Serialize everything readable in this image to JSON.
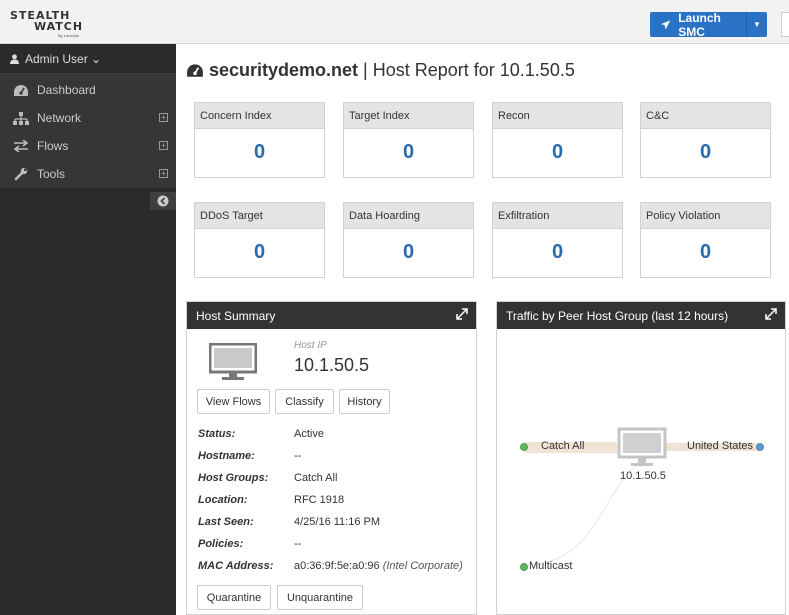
{
  "brand": {
    "line1": "STEALTH",
    "line2": "WATCH",
    "byline": "By Lancope"
  },
  "topbar": {
    "launch_label": "Launch SMC"
  },
  "sidebar": {
    "user": "Admin User ⌄",
    "items": [
      {
        "label": "Dashboard",
        "icon": "dashboard-icon"
      },
      {
        "label": "Network",
        "icon": "sitemap-icon"
      },
      {
        "label": "Flows",
        "icon": "exchange-icon"
      },
      {
        "label": "Tools",
        "icon": "wrench-icon"
      }
    ]
  },
  "page": {
    "domain": "securitydemo.net",
    "subtitle": " | Host Report for 10.1.50.5"
  },
  "indices": [
    {
      "label": "Concern Index",
      "value": "0"
    },
    {
      "label": "Target Index",
      "value": "0"
    },
    {
      "label": "Recon",
      "value": "0"
    },
    {
      "label": "C&C",
      "value": "0"
    },
    {
      "label": "DDoS Target",
      "value": "0"
    },
    {
      "label": "Data Hoarding",
      "value": "0"
    },
    {
      "label": "Exfiltration",
      "value": "0"
    },
    {
      "label": "Policy Violation",
      "value": "0"
    }
  ],
  "host_summary": {
    "title": "Host Summary",
    "host_ip_label": "Host IP",
    "host_ip": "10.1.50.5",
    "buttons": {
      "view_flows": "View Flows",
      "classify": "Classify",
      "history": "History",
      "quarantine": "Quarantine",
      "unquarantine": "Unquarantine"
    },
    "fields": [
      {
        "key": "Status:",
        "value": "Active"
      },
      {
        "key": "Hostname:",
        "value": "--"
      },
      {
        "key": "Host Groups:",
        "value": "Catch All"
      },
      {
        "key": "Location:",
        "value": "RFC 1918"
      },
      {
        "key": "Last Seen:",
        "value": "4/25/16 11:16 PM"
      },
      {
        "key": "Policies:",
        "value": "--"
      },
      {
        "key": "MAC Address:",
        "value": "a0:36:9f:5e:a0:96 "
      }
    ],
    "mac_vendor": "(Intel Corporate)"
  },
  "traffic": {
    "title": "Traffic by Peer Host Group (last 12 hours)",
    "left_top": "Catch All",
    "left_bottom": "Multicast",
    "center": "10.1.50.5",
    "right": "United States"
  },
  "colors": {
    "accent": "#2a72c5",
    "value_blue": "#2a6bb0",
    "node_green": "#5cb85c",
    "node_blue": "#5b9bd5",
    "flow": "#f1e3d3"
  }
}
